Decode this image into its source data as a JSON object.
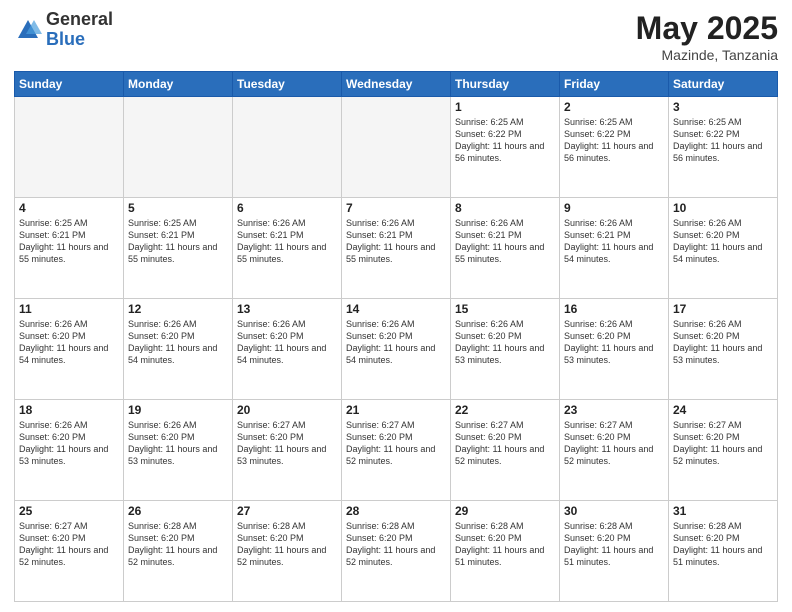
{
  "header": {
    "logo_general": "General",
    "logo_blue": "Blue",
    "title": "May 2025",
    "location": "Mazinde, Tanzania"
  },
  "weekdays": [
    "Sunday",
    "Monday",
    "Tuesday",
    "Wednesday",
    "Thursday",
    "Friday",
    "Saturday"
  ],
  "weeks": [
    [
      {
        "day": "",
        "empty": true
      },
      {
        "day": "",
        "empty": true
      },
      {
        "day": "",
        "empty": true
      },
      {
        "day": "",
        "empty": true
      },
      {
        "day": "1",
        "sunrise": "6:25 AM",
        "sunset": "6:22 PM",
        "daylight": "11 hours and 56 minutes."
      },
      {
        "day": "2",
        "sunrise": "6:25 AM",
        "sunset": "6:22 PM",
        "daylight": "11 hours and 56 minutes."
      },
      {
        "day": "3",
        "sunrise": "6:25 AM",
        "sunset": "6:22 PM",
        "daylight": "11 hours and 56 minutes."
      }
    ],
    [
      {
        "day": "4",
        "sunrise": "6:25 AM",
        "sunset": "6:21 PM",
        "daylight": "11 hours and 55 minutes."
      },
      {
        "day": "5",
        "sunrise": "6:25 AM",
        "sunset": "6:21 PM",
        "daylight": "11 hours and 55 minutes."
      },
      {
        "day": "6",
        "sunrise": "6:26 AM",
        "sunset": "6:21 PM",
        "daylight": "11 hours and 55 minutes."
      },
      {
        "day": "7",
        "sunrise": "6:26 AM",
        "sunset": "6:21 PM",
        "daylight": "11 hours and 55 minutes."
      },
      {
        "day": "8",
        "sunrise": "6:26 AM",
        "sunset": "6:21 PM",
        "daylight": "11 hours and 55 minutes."
      },
      {
        "day": "9",
        "sunrise": "6:26 AM",
        "sunset": "6:21 PM",
        "daylight": "11 hours and 54 minutes."
      },
      {
        "day": "10",
        "sunrise": "6:26 AM",
        "sunset": "6:20 PM",
        "daylight": "11 hours and 54 minutes."
      }
    ],
    [
      {
        "day": "11",
        "sunrise": "6:26 AM",
        "sunset": "6:20 PM",
        "daylight": "11 hours and 54 minutes."
      },
      {
        "day": "12",
        "sunrise": "6:26 AM",
        "sunset": "6:20 PM",
        "daylight": "11 hours and 54 minutes."
      },
      {
        "day": "13",
        "sunrise": "6:26 AM",
        "sunset": "6:20 PM",
        "daylight": "11 hours and 54 minutes."
      },
      {
        "day": "14",
        "sunrise": "6:26 AM",
        "sunset": "6:20 PM",
        "daylight": "11 hours and 54 minutes."
      },
      {
        "day": "15",
        "sunrise": "6:26 AM",
        "sunset": "6:20 PM",
        "daylight": "11 hours and 53 minutes."
      },
      {
        "day": "16",
        "sunrise": "6:26 AM",
        "sunset": "6:20 PM",
        "daylight": "11 hours and 53 minutes."
      },
      {
        "day": "17",
        "sunrise": "6:26 AM",
        "sunset": "6:20 PM",
        "daylight": "11 hours and 53 minutes."
      }
    ],
    [
      {
        "day": "18",
        "sunrise": "6:26 AM",
        "sunset": "6:20 PM",
        "daylight": "11 hours and 53 minutes."
      },
      {
        "day": "19",
        "sunrise": "6:26 AM",
        "sunset": "6:20 PM",
        "daylight": "11 hours and 53 minutes."
      },
      {
        "day": "20",
        "sunrise": "6:27 AM",
        "sunset": "6:20 PM",
        "daylight": "11 hours and 53 minutes."
      },
      {
        "day": "21",
        "sunrise": "6:27 AM",
        "sunset": "6:20 PM",
        "daylight": "11 hours and 52 minutes."
      },
      {
        "day": "22",
        "sunrise": "6:27 AM",
        "sunset": "6:20 PM",
        "daylight": "11 hours and 52 minutes."
      },
      {
        "day": "23",
        "sunrise": "6:27 AM",
        "sunset": "6:20 PM",
        "daylight": "11 hours and 52 minutes."
      },
      {
        "day": "24",
        "sunrise": "6:27 AM",
        "sunset": "6:20 PM",
        "daylight": "11 hours and 52 minutes."
      }
    ],
    [
      {
        "day": "25",
        "sunrise": "6:27 AM",
        "sunset": "6:20 PM",
        "daylight": "11 hours and 52 minutes."
      },
      {
        "day": "26",
        "sunrise": "6:28 AM",
        "sunset": "6:20 PM",
        "daylight": "11 hours and 52 minutes."
      },
      {
        "day": "27",
        "sunrise": "6:28 AM",
        "sunset": "6:20 PM",
        "daylight": "11 hours and 52 minutes."
      },
      {
        "day": "28",
        "sunrise": "6:28 AM",
        "sunset": "6:20 PM",
        "daylight": "11 hours and 52 minutes."
      },
      {
        "day": "29",
        "sunrise": "6:28 AM",
        "sunset": "6:20 PM",
        "daylight": "11 hours and 51 minutes."
      },
      {
        "day": "30",
        "sunrise": "6:28 AM",
        "sunset": "6:20 PM",
        "daylight": "11 hours and 51 minutes."
      },
      {
        "day": "31",
        "sunrise": "6:28 AM",
        "sunset": "6:20 PM",
        "daylight": "11 hours and 51 minutes."
      }
    ]
  ]
}
